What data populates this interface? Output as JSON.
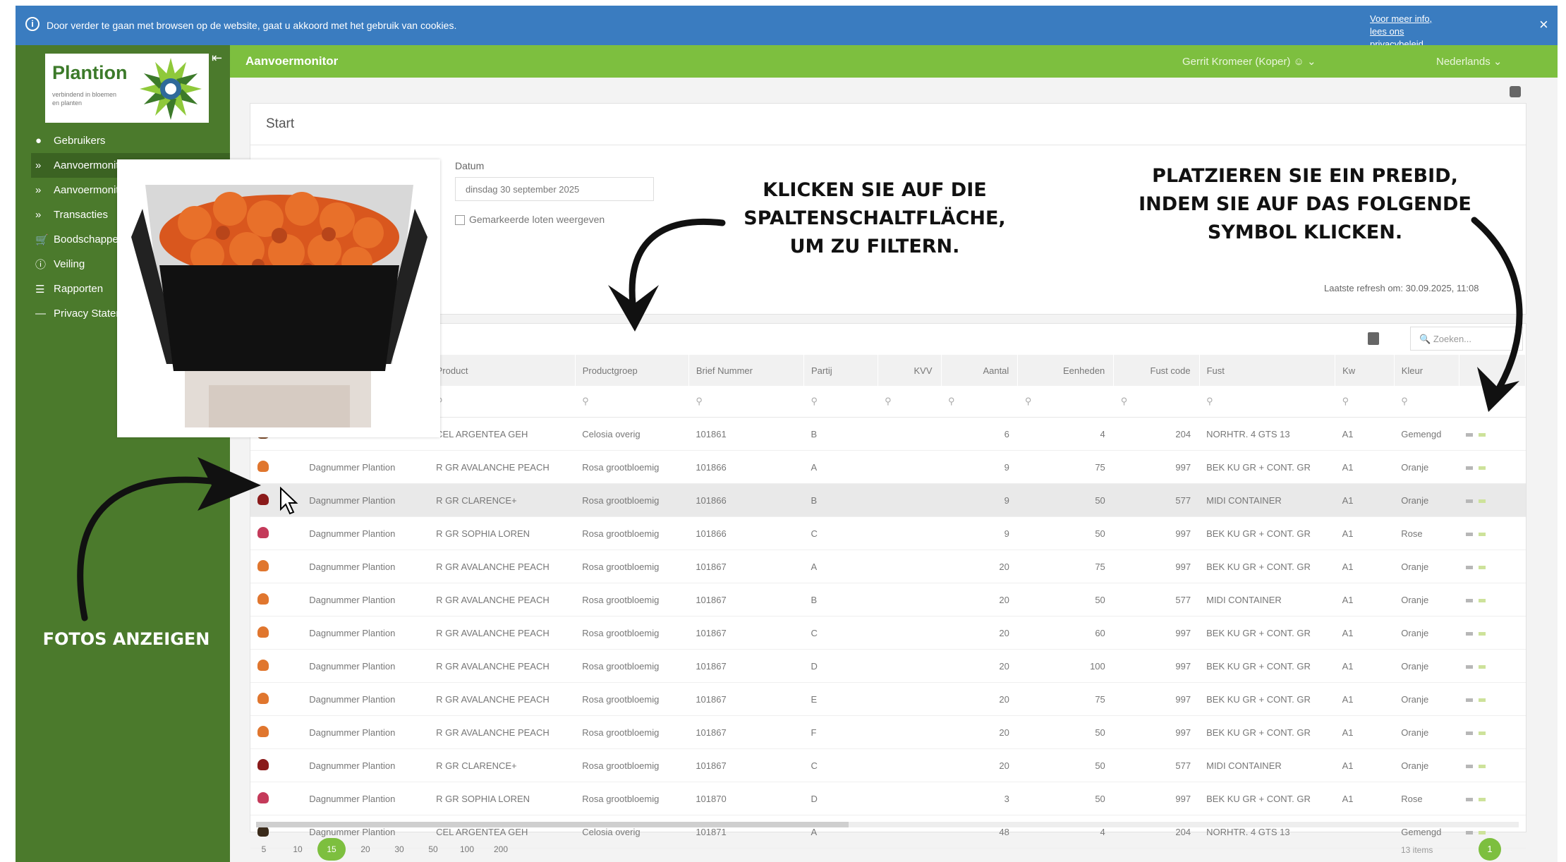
{
  "cookie_bar": {
    "message": "Door verder te gaan met browsen op de website, gaat u akkoord met het gebruik van cookies.",
    "more_info": "Voor meer info, lees ons privacybeleid",
    "close": "×"
  },
  "brand": {
    "logo_name": "Plantion",
    "logo_sub": "verbindend in bloemen en planten"
  },
  "sidebar": {
    "items": [
      {
        "label": "Gebruikers",
        "icon": "user-icon"
      },
      {
        "label": "Aanvoermonitor",
        "icon": "chevron-right-icon"
      },
      {
        "label": "Aanvoermonitor",
        "icon": "chevron-right-icon"
      },
      {
        "label": "Transacties",
        "icon": "chevron-right-icon"
      },
      {
        "label": "Boodschappen",
        "icon": "cart-icon"
      },
      {
        "label": "Veiling",
        "icon": "info-icon"
      },
      {
        "label": "Rapporten",
        "icon": "list-icon"
      },
      {
        "label": "Privacy Statement",
        "icon": "dash-icon"
      }
    ]
  },
  "topbar": {
    "title": "Aanvoermonitor",
    "user": "Gerrit Kromeer (Koper)",
    "language": "Nederlands"
  },
  "start_panel": {
    "title": "Start",
    "datum_label": "Datum",
    "datum_value": "dinsdag 30 september 2025",
    "checkbox_label": "Gemarkeerde loten weergeven",
    "last_refresh": "Laatste refresh om: 30.09.2025, 11:08"
  },
  "grid": {
    "search_placeholder": "Zoeken...",
    "columns": [
      "",
      "",
      "Product",
      "Productgroep",
      "Brief Nummer",
      "Partij",
      "KVV",
      "Aantal",
      "Eenheden",
      "Fust code",
      "Fust",
      "Kw",
      "Kleur",
      ""
    ],
    "rows": [
      {
        "thumb": "#7a4a2a",
        "supplier": "",
        "product": "CEL ARGENTEA GEH",
        "group": "Celosia overig",
        "brief": "101861",
        "partij": "B",
        "kvv": "",
        "aantal": "6",
        "eenheden": "4",
        "fustcode": "204",
        "fust": "NORHTR. 4 GTS 13",
        "kw": "A1",
        "kleur": "Gemengd",
        "hl": false
      },
      {
        "thumb": "#e0762e",
        "supplier": "Dagnummer Plantion",
        "product": "R GR AVALANCHE PEACH",
        "group": "Rosa grootbloemig",
        "brief": "101866",
        "partij": "A",
        "kvv": "",
        "aantal": "9",
        "eenheden": "75",
        "fustcode": "997",
        "fust": "BEK KU GR + CONT. GR",
        "kw": "A1",
        "kleur": "Oranje",
        "hl": false
      },
      {
        "thumb": "#8a1a1a",
        "supplier": "Dagnummer Plantion",
        "product": "R GR CLARENCE+",
        "group": "Rosa grootbloemig",
        "brief": "101866",
        "partij": "B",
        "kvv": "",
        "aantal": "9",
        "eenheden": "50",
        "fustcode": "577",
        "fust": "MIDI CONTAINER",
        "kw": "A1",
        "kleur": "Oranje",
        "hl": true
      },
      {
        "thumb": "#c43a5a",
        "supplier": "Dagnummer Plantion",
        "product": "R GR SOPHIA LOREN",
        "group": "Rosa grootbloemig",
        "brief": "101866",
        "partij": "C",
        "kvv": "",
        "aantal": "9",
        "eenheden": "50",
        "fustcode": "997",
        "fust": "BEK KU GR + CONT. GR",
        "kw": "A1",
        "kleur": "Rose",
        "hl": false
      },
      {
        "thumb": "#e0762e",
        "supplier": "Dagnummer Plantion",
        "product": "R GR AVALANCHE PEACH",
        "group": "Rosa grootbloemig",
        "brief": "101867",
        "partij": "A",
        "kvv": "",
        "aantal": "20",
        "eenheden": "75",
        "fustcode": "997",
        "fust": "BEK KU GR + CONT. GR",
        "kw": "A1",
        "kleur": "Oranje",
        "hl": false
      },
      {
        "thumb": "#e0762e",
        "supplier": "Dagnummer Plantion",
        "product": "R GR AVALANCHE PEACH",
        "group": "Rosa grootbloemig",
        "brief": "101867",
        "partij": "B",
        "kvv": "",
        "aantal": "20",
        "eenheden": "50",
        "fustcode": "577",
        "fust": "MIDI CONTAINER",
        "kw": "A1",
        "kleur": "Oranje",
        "hl": false
      },
      {
        "thumb": "#e0762e",
        "supplier": "Dagnummer Plantion",
        "product": "R GR AVALANCHE PEACH",
        "group": "Rosa grootbloemig",
        "brief": "101867",
        "partij": "C",
        "kvv": "",
        "aantal": "20",
        "eenheden": "60",
        "fustcode": "997",
        "fust": "BEK KU GR + CONT. GR",
        "kw": "A1",
        "kleur": "Oranje",
        "hl": false
      },
      {
        "thumb": "#e0762e",
        "supplier": "Dagnummer Plantion",
        "product": "R GR AVALANCHE PEACH",
        "group": "Rosa grootbloemig",
        "brief": "101867",
        "partij": "D",
        "kvv": "",
        "aantal": "20",
        "eenheden": "100",
        "fustcode": "997",
        "fust": "BEK KU GR + CONT. GR",
        "kw": "A1",
        "kleur": "Oranje",
        "hl": false
      },
      {
        "thumb": "#e0762e",
        "supplier": "Dagnummer Plantion",
        "product": "R GR AVALANCHE PEACH",
        "group": "Rosa grootbloemig",
        "brief": "101867",
        "partij": "E",
        "kvv": "",
        "aantal": "20",
        "eenheden": "75",
        "fustcode": "997",
        "fust": "BEK KU GR + CONT. GR",
        "kw": "A1",
        "kleur": "Oranje",
        "hl": false
      },
      {
        "thumb": "#e0762e",
        "supplier": "Dagnummer Plantion",
        "product": "R GR AVALANCHE PEACH",
        "group": "Rosa grootbloemig",
        "brief": "101867",
        "partij": "F",
        "kvv": "",
        "aantal": "20",
        "eenheden": "50",
        "fustcode": "997",
        "fust": "BEK KU GR + CONT. GR",
        "kw": "A1",
        "kleur": "Oranje",
        "hl": false
      },
      {
        "thumb": "#8a1a1a",
        "supplier": "Dagnummer Plantion",
        "product": "R GR CLARENCE+",
        "group": "Rosa grootbloemig",
        "brief": "101867",
        "partij": "C",
        "kvv": "",
        "aantal": "20",
        "eenheden": "50",
        "fustcode": "577",
        "fust": "MIDI CONTAINER",
        "kw": "A1",
        "kleur": "Oranje",
        "hl": false
      },
      {
        "thumb": "#c43a5a",
        "supplier": "Dagnummer Plantion",
        "product": "R GR SOPHIA LOREN",
        "group": "Rosa grootbloemig",
        "brief": "101870",
        "partij": "D",
        "kvv": "",
        "aantal": "3",
        "eenheden": "50",
        "fustcode": "997",
        "fust": "BEK KU GR + CONT. GR",
        "kw": "A1",
        "kleur": "Rose",
        "hl": false
      },
      {
        "thumb": "#3a2a1a",
        "supplier": "Dagnummer Plantion",
        "product": "CEL ARGENTEA GEH",
        "group": "Celosia overig",
        "brief": "101871",
        "partij": "A",
        "kvv": "",
        "aantal": "48",
        "eenheden": "4",
        "fustcode": "204",
        "fust": "NORHTR. 4 GTS 13",
        "kw": "",
        "kleur": "Gemengd",
        "hl": false
      }
    ]
  },
  "pager": {
    "sizes": [
      "5",
      "10",
      "15",
      "20",
      "30",
      "50",
      "100",
      "200"
    ],
    "active_size": "15",
    "count": "13 items",
    "page": "1"
  },
  "annotations": {
    "filter": "KLICKEN SIE AUF DIE SPALTENSCHALTFLÄCHE, UM ZU FILTERN.",
    "prebid": "PLATZIEREN SIE EIN PREBID, INDEM SIE AUF DAS FOLGENDE SYMBOL KLICKEN.",
    "fotos": "FOTOS ANZEIGEN"
  },
  "colors": {
    "cookie_bar": "#3a7cc0",
    "sidebar": "#4b7a2c",
    "topbar": "#7dbf3f"
  }
}
